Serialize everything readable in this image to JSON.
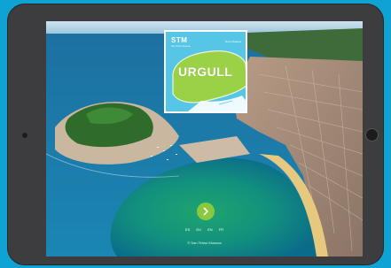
{
  "logo_card": {
    "brand": "STM",
    "brand_sub": "San Telmo Museoa",
    "brand_right": "Gure Museoa",
    "title": "URGULL"
  },
  "start": {
    "icon": "chevron-right-icon"
  },
  "languages": [
    "ES",
    "EU",
    "EN",
    "FR"
  ],
  "footer": {
    "copyright": "© San Telmo Museoa"
  },
  "colors": {
    "page_background": "#0fa3d4",
    "tablet_frame": "#3d3d3f",
    "logo_card": "#57c5e6",
    "map_land": "#9bd147",
    "go_button": "#8cc83f"
  }
}
